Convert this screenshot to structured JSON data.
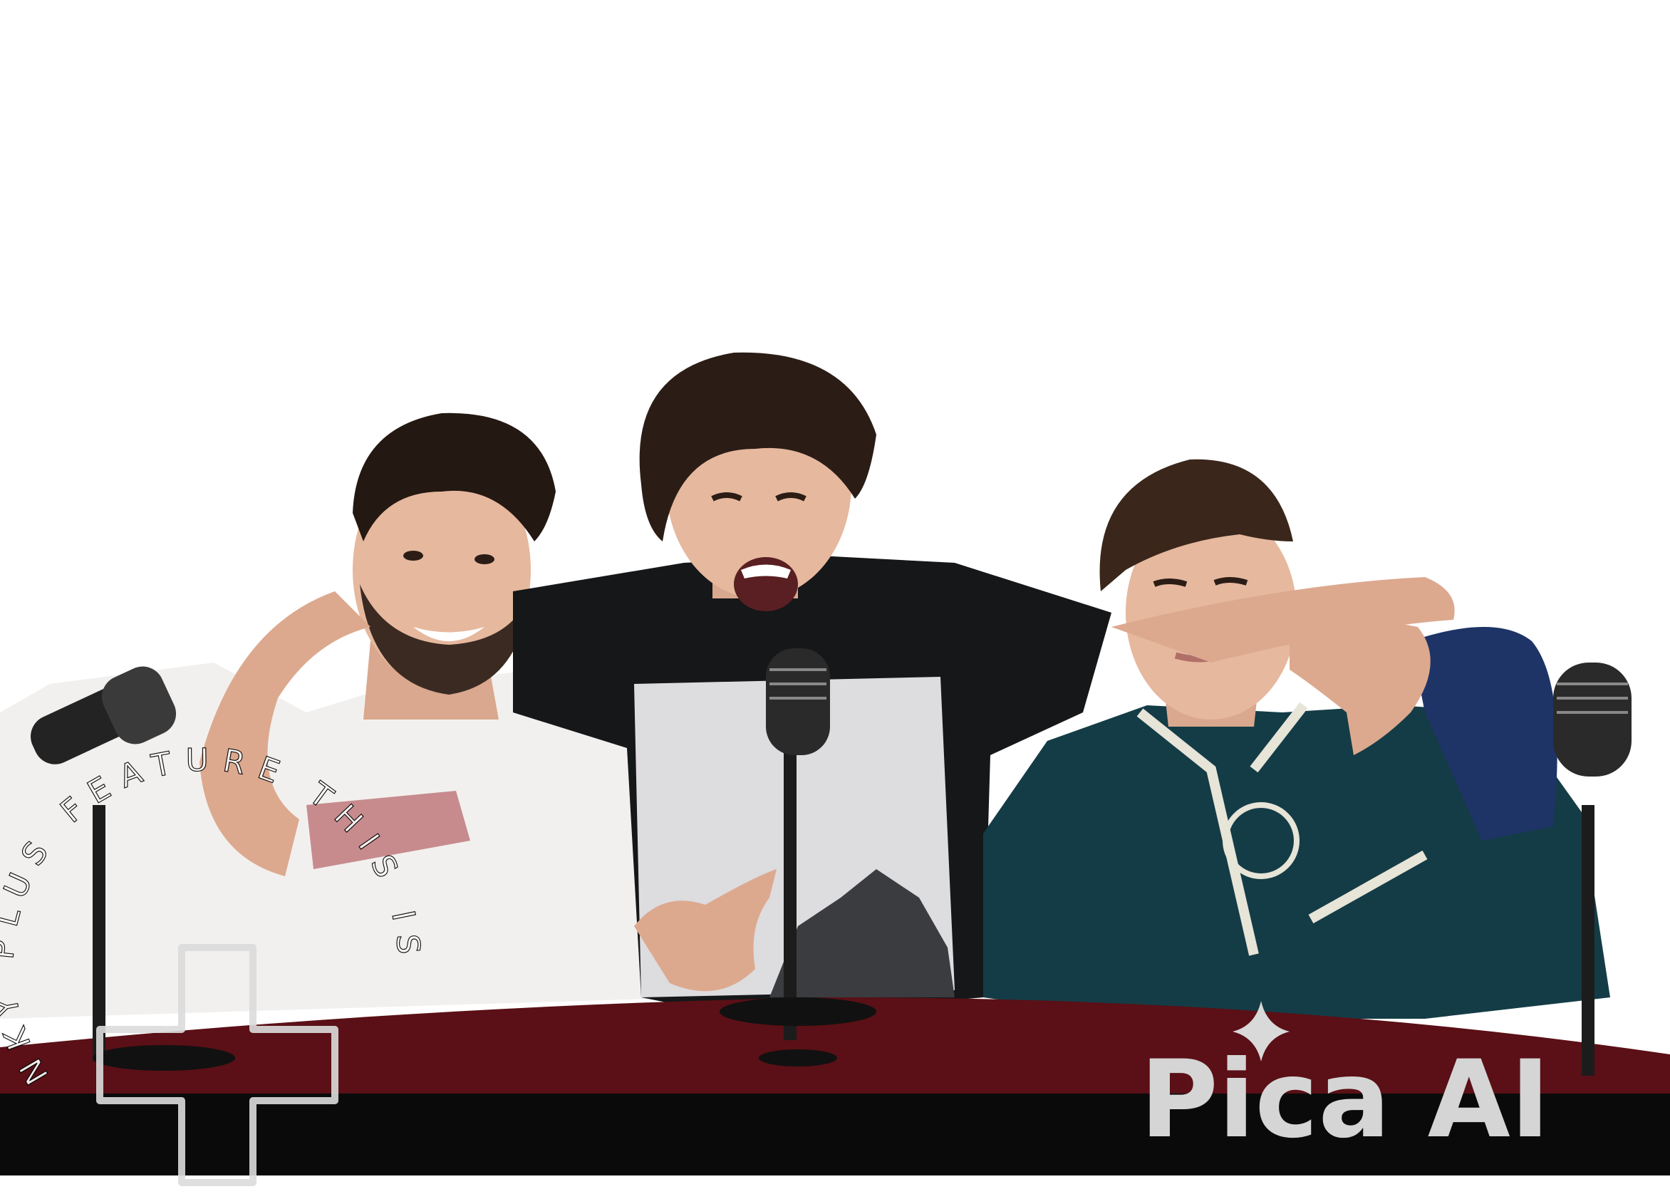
{
  "photo": {
    "colors": {
      "background": "#ffffff",
      "desk": "#5a1016",
      "desk_front": "#0a0a0a",
      "shirt_white": "#f2f0ee",
      "shirt_black": "#151719",
      "hoodie_teal": "#143c46",
      "sleeve_navy": "#1e3466",
      "hair": "#2b1d16",
      "skin": "#e6b89e",
      "mic": "#1c1c1c"
    }
  },
  "badge": {
    "arc_text": "NKY PLUS FEATURE THIS IS",
    "icon": "plus-cross-icon"
  },
  "watermark": {
    "brand": "Pica AI",
    "icon": "sparkle-icon"
  }
}
